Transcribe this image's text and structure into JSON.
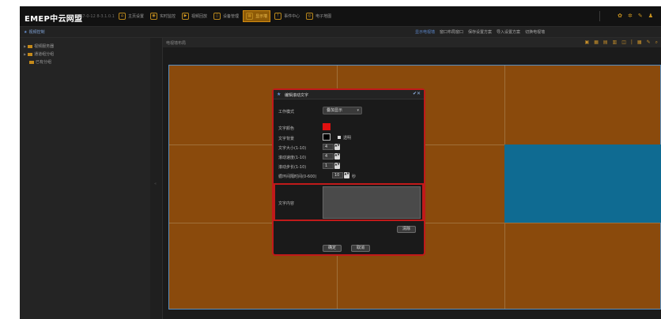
{
  "app": {
    "logo": "EMEP中云网盟",
    "logo_sub": "TCS7-0-12 8-3.1.0.1"
  },
  "nav": [
    {
      "label": "主页设置",
      "icon": "home-icon"
    },
    {
      "label": "实时监控",
      "icon": "camera-icon"
    },
    {
      "label": "视频回放",
      "icon": "play-icon"
    },
    {
      "label": "设备管理",
      "icon": "device-icon"
    },
    {
      "label": "显示墙",
      "icon": "wall-icon",
      "active": true
    },
    {
      "label": "事件中心",
      "icon": "event-icon"
    },
    {
      "label": "电子地图",
      "icon": "map-icon"
    }
  ],
  "top_icons": [
    "settings-icon",
    "gear-icon",
    "lock-icon",
    "user-icon"
  ],
  "subbar": {
    "title": "视频控制",
    "toolbar": [
      "显示电视墙",
      "窗口布局窗口",
      "保存设置方案",
      "导入设置方案",
      "切换电视墙"
    ]
  },
  "sidebar": {
    "items": [
      {
        "label": "视频服务器"
      },
      {
        "label": "通道组分组"
      },
      {
        "label": "已有分组"
      }
    ]
  },
  "main": {
    "header_label": "电视墙布局"
  },
  "dialog": {
    "title": "编辑滚动文字",
    "mode_label": "工作模式",
    "mode_value": "叠加显示",
    "text_color_label": "文字颜色",
    "text_color": "#e01010",
    "bg_label": "文字背景",
    "bg_color": "#000000",
    "transparent_label": "透明",
    "font_size_label": "文字大小(1-10)",
    "font_size_value": "4",
    "speed_label": "滚动速度(1-10)",
    "speed_value": "4",
    "step_label": "滚动步长(1-10)",
    "step_value": "1",
    "interval_label": "循环间隔时间(0-600)",
    "interval_value": "10",
    "interval_unit": "秒",
    "content_label": "文字内容",
    "content_value": "",
    "clear_button": "清除",
    "ok_button": "确定",
    "cancel_button": "取消"
  },
  "colors": {
    "accent": "#d28b11",
    "grid_cell": "#8a4a0c",
    "blue_cell": "#0f6b92",
    "highlight_border": "#c11a1a"
  }
}
